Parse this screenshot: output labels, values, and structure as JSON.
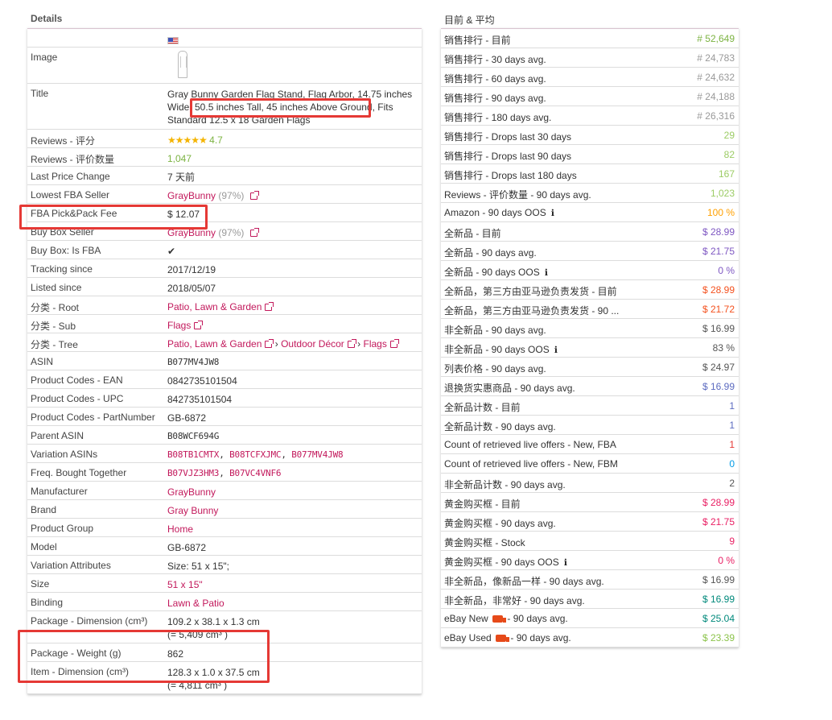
{
  "left_panel": {
    "title": "Details",
    "rows": {
      "image_label": "Image",
      "title_label": "Title",
      "title_value": "Gray Bunny Garden Flag Stand, Flag Arbor, 14.75 inches Wide, 50.5 inches Tall, 45 inches Above Ground, Fits Standard 12.5 x 18 Garden Flags",
      "reviews_rating_label": "Reviews - 评分",
      "reviews_rating_value": "4.7",
      "reviews_rating_stars": 4.7,
      "reviews_count_label": "Reviews - 评价数量",
      "reviews_count_value": "1,047",
      "last_price_change_label": "Last Price Change",
      "last_price_change_value": "7 天前",
      "lowest_fba_label": "Lowest FBA Seller",
      "lowest_fba_seller": "GrayBunny",
      "lowest_fba_pct": "(97%)",
      "fba_fee_label": "FBA Pick&Pack Fee",
      "fba_fee_value": "$ 12.07",
      "buybox_seller_label": "Buy Box Seller",
      "buybox_seller": "GrayBunny",
      "buybox_pct": "(97%)",
      "buybox_fba_label": "Buy Box: Is FBA",
      "buybox_fba_value": "✔",
      "tracking_since_label": "Tracking since",
      "tracking_since_value": "2017/12/19",
      "listed_since_label": "Listed since",
      "listed_since_value": "2018/05/07",
      "cat_root_label": "分类 - Root",
      "cat_root_value": "Patio, Lawn & Garden",
      "cat_sub_label": "分类 - Sub",
      "cat_sub_value": "Flags",
      "cat_tree_label": "分类 - Tree",
      "cat_tree_1": "Patio, Lawn & Garden",
      "cat_tree_sep": "›",
      "cat_tree_2": "Outdoor Décor",
      "cat_tree_3": "Flags",
      "asin_label": "ASIN",
      "asin_value": "B077MV4JW8",
      "ean_label": "Product Codes - EAN",
      "ean_value": "0842735101504",
      "upc_label": "Product Codes - UPC",
      "upc_value": "842735101504",
      "partnumber_label": "Product Codes - PartNumber",
      "partnumber_value": "GB-6872",
      "parent_asin_label": "Parent ASIN",
      "parent_asin_value": "B08WCF694G",
      "variation_asins_label": "Variation ASINs",
      "variation_asin_1": "B08TB1CMTX",
      "variation_asin_2": "B08TCFXJMC",
      "variation_asin_3": "B077MV4JW8",
      "fbt_label": "Freq. Bought Together",
      "fbt_1": "B07VJZ3HM3",
      "fbt_2": "B07VC4VNF6",
      "manufacturer_label": "Manufacturer",
      "manufacturer_value": "GrayBunny",
      "brand_label": "Brand",
      "brand_value": "Gray Bunny",
      "product_group_label": "Product Group",
      "product_group_value": "Home",
      "model_label": "Model",
      "model_value": "GB-6872",
      "variation_attr_label": "Variation Attributes",
      "variation_attr_value": "Size: 51 x 15\";",
      "size_label": "Size",
      "size_value": "51 x 15\"",
      "binding_label": "Binding",
      "binding_value": "Lawn & Patio",
      "pkg_dim_label": "Package - Dimension (cm³)",
      "pkg_dim_value": "109.2 x 38.1 x 1.3 cm",
      "pkg_dim_volume": "(= 5,409 cm³ )",
      "pkg_weight_label": "Package - Weight (g)",
      "pkg_weight_value": "862",
      "item_dim_label": "Item - Dimension (cm³)",
      "item_dim_value": "128.3 x 1.0 x 37.5 cm",
      "item_dim_volume": "(= 4,811 cm³ )"
    }
  },
  "right_panel": {
    "title": "目前 & 平均",
    "rows": [
      {
        "label": "销售排行 - 目前",
        "value": "# 52,649",
        "color": "#7cb342"
      },
      {
        "label": "销售排行 - 30 days avg.",
        "value": "# 24,783",
        "color": "#999999"
      },
      {
        "label": "销售排行 - 60 days avg.",
        "value": "# 24,632",
        "color": "#999999"
      },
      {
        "label": "销售排行 - 90 days avg.",
        "value": "# 24,188",
        "color": "#999999"
      },
      {
        "label": "销售排行 - 180 days avg.",
        "value": "# 26,316",
        "color": "#999999"
      },
      {
        "label": "销售排行 - Drops last 30 days",
        "value": "29",
        "color": "#9ccc65"
      },
      {
        "label": "销售排行 - Drops last 90 days",
        "value": "82",
        "color": "#9ccc65"
      },
      {
        "label": "销售排行 - Drops last 180 days",
        "value": "167",
        "color": "#9ccc65"
      },
      {
        "label": "Reviews - 评价数量 - 90 days avg.",
        "value": "1,023",
        "color": "#9ccc65"
      },
      {
        "label": "Amazon - 90 days OOS",
        "value": "100 %",
        "color": "#ffa000",
        "info": "ℹ"
      },
      {
        "label": "全新品 - 目前",
        "value": "$ 28.99",
        "color": "#7e57c2"
      },
      {
        "label": "全新品 - 90 days avg.",
        "value": "$ 21.75",
        "color": "#7e57c2"
      },
      {
        "label": "全新品 - 90 days OOS",
        "value": "0 %",
        "color": "#7e57c2",
        "info": "ℹ"
      },
      {
        "label": "全新品，第三方由亚马逊负责发货 - 目前",
        "value": "$ 28.99",
        "color": "#f4511e"
      },
      {
        "label": "全新品，第三方由亚马逊负责发货 - 90 ...",
        "value": "$ 21.72",
        "color": "#f4511e"
      },
      {
        "label": "非全新品 - 90 days avg.",
        "value": "$ 16.99",
        "color": "#555555"
      },
      {
        "label": "非全新品 - 90 days OOS",
        "value": "83 %",
        "color": "#555555",
        "info": "ℹ"
      },
      {
        "label": "列表价格 - 90 days avg.",
        "value": "$ 24.97",
        "color": "#555555"
      },
      {
        "label": "退换货实惠商品 - 90 days avg.",
        "value": "$ 16.99",
        "color": "#5c6bc0"
      },
      {
        "label": "全新品计数 - 目前",
        "value": "1",
        "color": "#5c6bc0"
      },
      {
        "label": "全新品计数 - 90 days avg.",
        "value": "1",
        "color": "#5c6bc0"
      },
      {
        "label": "Count of retrieved live offers - New, FBA",
        "value": "1",
        "color": "#e53935"
      },
      {
        "label": "Count of retrieved live offers - New, FBM",
        "value": "0",
        "color": "#039be5"
      },
      {
        "label": "非全新品计数 - 90 days avg.",
        "value": "2",
        "color": "#555555"
      },
      {
        "label": "黄金购买框 - 目前",
        "value": "$ 28.99",
        "color": "#e91e63"
      },
      {
        "label": "黄金购买框 - 90 days avg.",
        "value": "$ 21.75",
        "color": "#e91e63"
      },
      {
        "label": "黄金购买框 - Stock",
        "value": "9",
        "color": "#e91e63"
      },
      {
        "label": "黄金购买框 - 90 days OOS",
        "value": "0 %",
        "color": "#e91e63",
        "info": "ℹ"
      },
      {
        "label": "非全新品，像新品一样 - 90 days avg.",
        "value": "$ 16.99",
        "color": "#555555"
      },
      {
        "label": "非全新品，非常好 - 90 days avg.",
        "value": "$ 16.99",
        "color": "#00897b"
      },
      {
        "label": "eBay New",
        "label_suffix": "- 90 days avg.",
        "truck": true,
        "value": "$ 25.04",
        "color": "#00897b"
      },
      {
        "label": "eBay Used",
        "label_suffix": "- 90 days avg.",
        "truck": true,
        "value": "$ 23.39",
        "color": "#8bc34a"
      }
    ]
  },
  "colors": {
    "link": "#c2185b",
    "highlight": "#e53935",
    "table_top_border": "#d9c3d0"
  }
}
